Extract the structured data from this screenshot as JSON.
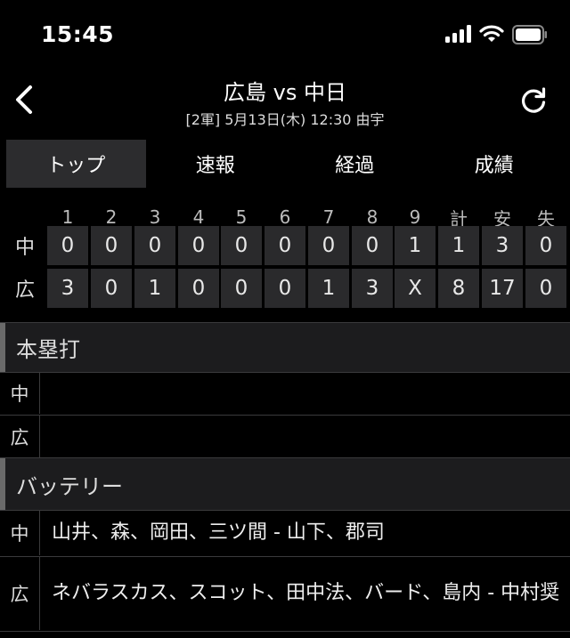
{
  "status_bar": {
    "time": "15:45",
    "icons": [
      "signal-icon",
      "wifi-icon",
      "battery-icon"
    ]
  },
  "header": {
    "title": "広島 vs 中日",
    "subtitle": "[2軍] 5月13日(木) 12:30 由宇",
    "back_icon": "chevron-left-icon",
    "refresh_icon": "refresh-icon"
  },
  "tabs": [
    {
      "label": "トップ",
      "active": true
    },
    {
      "label": "速報",
      "active": false
    },
    {
      "label": "経過",
      "active": false
    },
    {
      "label": "成績",
      "active": false
    }
  ],
  "scoreboard": {
    "headers": [
      "1",
      "2",
      "3",
      "4",
      "5",
      "6",
      "7",
      "8",
      "9",
      "計",
      "安",
      "失"
    ],
    "rows": [
      {
        "team": "中",
        "cells": [
          "0",
          "0",
          "0",
          "0",
          "0",
          "0",
          "0",
          "0",
          "1",
          "1",
          "3",
          "0"
        ]
      },
      {
        "team": "広",
        "cells": [
          "3",
          "0",
          "1",
          "0",
          "0",
          "0",
          "1",
          "3",
          "X",
          "8",
          "17",
          "0"
        ]
      }
    ]
  },
  "home_runs": {
    "title": "本塁打",
    "rows": [
      {
        "team": "中",
        "value": ""
      },
      {
        "team": "広",
        "value": ""
      }
    ]
  },
  "battery": {
    "title": "バッテリー",
    "rows": [
      {
        "team": "中",
        "value": "山井、森、岡田、三ツ間 - 山下、郡司"
      },
      {
        "team": "広",
        "value": "ネバラスカス、スコット、田中法、バード、島内 - 中村奨"
      }
    ]
  },
  "colors": {
    "background": "#000000",
    "cell": "#2a2a2c",
    "active_tab": "#2c2c2e",
    "section_head": "#1c1c1e"
  }
}
